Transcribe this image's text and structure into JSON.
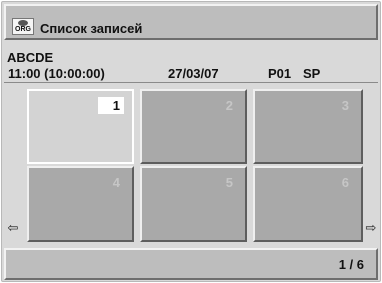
{
  "header": {
    "icon": "org-disc-icon",
    "icon_label": "ORG",
    "title": "Список записей"
  },
  "recording": {
    "name": "ABCDE",
    "time": "11:00 (10:00:00)",
    "date": "27/03/07",
    "program": "P01",
    "mode": "SP"
  },
  "thumbnails": [
    {
      "number": "1",
      "selected": true
    },
    {
      "number": "2",
      "selected": false
    },
    {
      "number": "3",
      "selected": false
    },
    {
      "number": "4",
      "selected": false
    },
    {
      "number": "5",
      "selected": false
    },
    {
      "number": "6",
      "selected": false
    }
  ],
  "navigation": {
    "left_arrow": "⇦",
    "right_arrow": "⇨"
  },
  "status": {
    "page": "1 / 6"
  },
  "colors": {
    "frame": "#d9d9d9",
    "thumbnail": "#a9a9a9",
    "selected_thumbnail": "#d3d3d3"
  }
}
